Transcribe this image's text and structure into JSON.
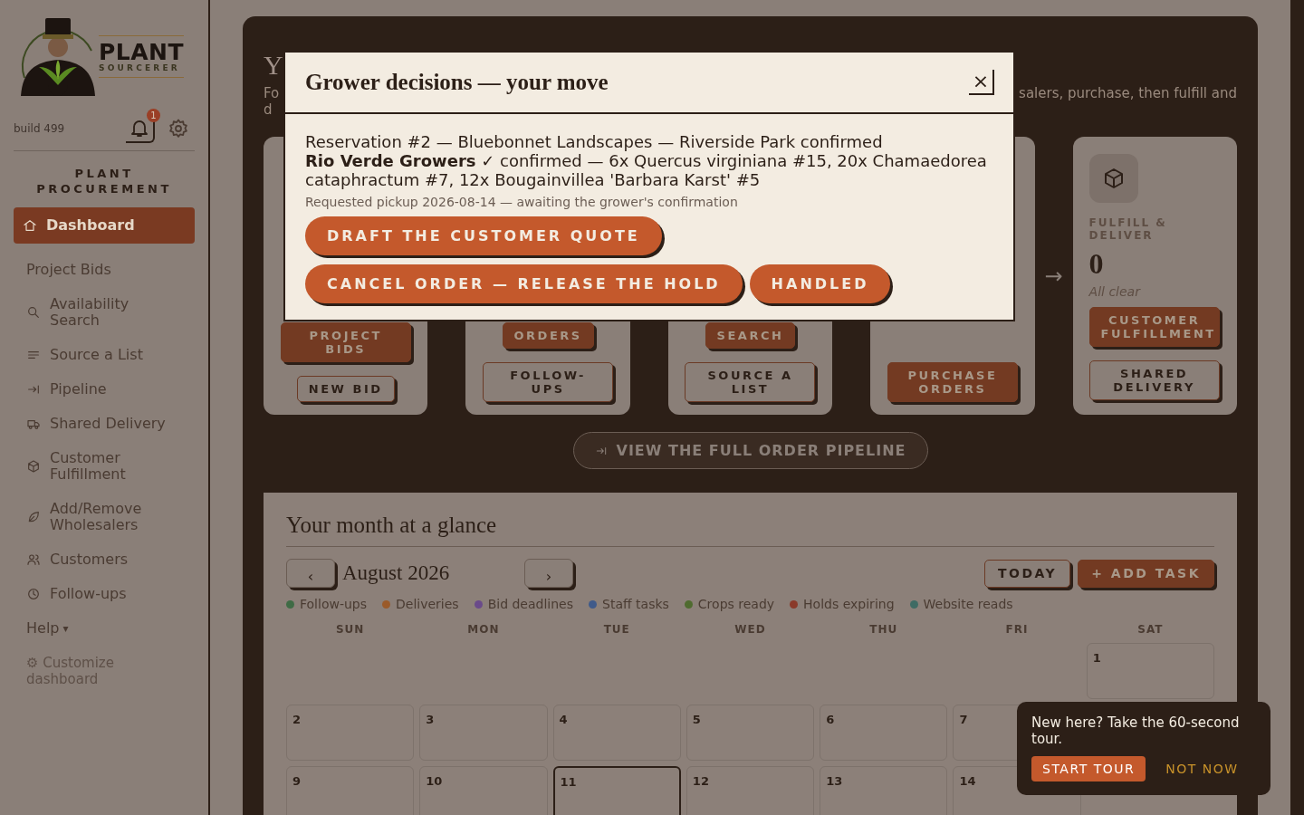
{
  "sidebar": {
    "logo": {
      "word_1": "PLANT",
      "word_2": "SOURCERER"
    },
    "build": "build 499",
    "notifications": {
      "count": "1"
    },
    "section_title": "PLANT PROCUREMENT",
    "items": [
      {
        "label": "Dashboard",
        "selected": true
      },
      {
        "label": "Project Bids",
        "selected": false
      },
      {
        "label": "Availability Search",
        "selected": false
      },
      {
        "label": "Source a List",
        "selected": false
      },
      {
        "label": "Pipeline",
        "selected": false
      },
      {
        "label": "Shared Delivery",
        "selected": false
      },
      {
        "label": "Customer Fulfillment",
        "selected": false
      },
      {
        "label": "Add/Remove Wholesalers",
        "selected": false
      },
      {
        "label": "Customers",
        "selected": false
      },
      {
        "label": "Follow-ups",
        "selected": false
      }
    ],
    "help": {
      "label": "Help",
      "caret": "▾"
    },
    "customize": {
      "icon": "⚙",
      "label": "Customize dashboard"
    }
  },
  "main": {
    "heading": "Y",
    "subtitle_fragments": [
      "Fo",
      "salers, purchase, then fulfill and",
      "d"
    ],
    "pipeline": {
      "arrow": "→",
      "cards": [
        {
          "buttons": [
            {
              "label": "PROJECT BIDS",
              "kind": "filled"
            },
            {
              "label": "NEW BID",
              "kind": "outline"
            }
          ]
        },
        {
          "buttons": [
            {
              "label": "ORDERS",
              "kind": "filled"
            },
            {
              "label": "FOLLOW-UPS",
              "kind": "outline"
            }
          ]
        },
        {
          "buttons": [
            {
              "label": "SEARCH",
              "kind": "filled"
            },
            {
              "label": "SOURCE A LIST",
              "kind": "outline"
            }
          ]
        },
        {
          "buttons": [
            {
              "label": "PURCHASE ORDERS",
              "kind": "filled"
            }
          ]
        },
        {
          "title": "FULFILL & DELIVER",
          "count": "0",
          "status": "All clear",
          "buttons": [
            {
              "label": "CUSTOMER FULFILLMENT",
              "kind": "filled"
            },
            {
              "label": "SHARED DELIVERY",
              "kind": "outline"
            }
          ]
        }
      ]
    },
    "pipeline_link": "VIEW THE FULL ORDER PIPELINE"
  },
  "calendar": {
    "title": "Your month at a glance",
    "prev": "‹",
    "month": "August 2026",
    "next": "›",
    "today_button": "TODAY",
    "add_button": "+ ADD TASK",
    "legend": [
      {
        "label": "Follow-ups",
        "color": "#3f6b45"
      },
      {
        "label": "Deliveries",
        "color": "#9a5a2a"
      },
      {
        "label": "Bid deadlines",
        "color": "#6a4a8a"
      },
      {
        "label": "Staff tasks",
        "color": "#3f5a8a"
      },
      {
        "label": "Crops ready",
        "color": "#4f6b2f"
      },
      {
        "label": "Holds expiring",
        "color": "#8a3a2a"
      },
      {
        "label": "Website reads",
        "color": "#3f6b64"
      }
    ],
    "weekdays": [
      "SUN",
      "MON",
      "TUE",
      "WED",
      "THU",
      "FRI",
      "SAT"
    ],
    "weeks": [
      [
        {
          "kind": "blank"
        },
        {
          "kind": "blank"
        },
        {
          "kind": "blank"
        },
        {
          "kind": "blank"
        },
        {
          "kind": "blank"
        },
        {
          "kind": "blank"
        },
        {
          "kind": "day",
          "day": "1",
          "today": false
        }
      ],
      [
        {
          "kind": "day",
          "day": "2",
          "today": false
        },
        {
          "kind": "day",
          "day": "3",
          "today": false
        },
        {
          "kind": "day",
          "day": "4",
          "today": false
        },
        {
          "kind": "day",
          "day": "5",
          "today": false
        },
        {
          "kind": "day",
          "day": "6",
          "today": false
        },
        {
          "kind": "day",
          "day": "7",
          "today": false
        }
      ],
      [
        {
          "kind": "day",
          "day": "9",
          "today": false
        },
        {
          "kind": "day",
          "day": "10",
          "today": false
        },
        {
          "kind": "day",
          "day": "11",
          "today": true
        },
        {
          "kind": "day",
          "day": "12",
          "today": false
        },
        {
          "kind": "day",
          "day": "13",
          "today": false
        },
        {
          "kind": "day",
          "day": "14",
          "today": false
        }
      ]
    ]
  },
  "dialog": {
    "title": "Grower decisions — your move",
    "close": "×",
    "lines": [
      "Reservation #2 — Bluebonnet Landscapes — Riverside Park confirmed",
      "**Rio Verde Growers** ✓ confirmed — 6x Quercus virginiana #15, 20x Chamaedorea cataphractum #7, 12x Bougainvillea 'Barbara Karst' #5"
    ],
    "note": "Requested pickup 2026-08-14 — awaiting the grower's confirmation",
    "button_rows": [
      [
        "DRAFT THE CUSTOMER QUOTE"
      ],
      [
        "CANCEL ORDER — RELEASE THE HOLD",
        "HANDLED"
      ]
    ]
  },
  "tour": {
    "text": "New here? Take the 60-second tour.",
    "start": "START TOUR",
    "dismiss": "NOT NOW"
  }
}
